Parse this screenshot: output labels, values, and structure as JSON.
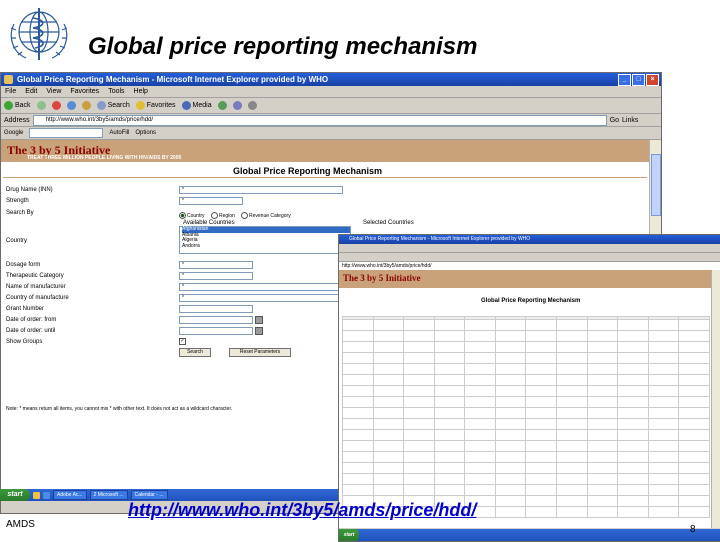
{
  "slide": {
    "title": "Global price reporting mechanism",
    "footer_left": "AMDS",
    "footer_url": "http://www.who.int/3by5/amds/price/hdd/",
    "page_number": "8"
  },
  "browser": {
    "window_title": "Global Price Reporting Mechanism - Microsoft Internet Explorer provided by WHO",
    "menu": [
      "File",
      "Edit",
      "View",
      "Favorites",
      "Tools",
      "Help"
    ],
    "toolbar": {
      "back": "Back",
      "search": "Search",
      "favorites": "Favorites",
      "media": "Media"
    },
    "address_label": "Address",
    "address_value": "http://www.who.int/3by5/amds/price/hdd/",
    "go_label": "Go",
    "links_label": "Links",
    "google_label": "Google",
    "links_items": [
      "AutoFill",
      "Options"
    ],
    "banner_logo": "The 3 by 5 Initiative",
    "banner_tagline": "TREAT THREE MILLION PEOPLE LIVING WITH HIV/AIDS BY 2005",
    "page_heading": "Global Price Reporting Mechanism",
    "form": {
      "drug_name_label": "Drug Name (INN)",
      "drug_name_value": "*",
      "strength_label": "Strength",
      "strength_value": "*",
      "search_by_label": "Search By",
      "radio_country": "Country",
      "radio_region": "Region",
      "radio_revenue": "Revenue Category",
      "available_countries_label": "Available Countries",
      "selected_countries_label": "Selected Countries",
      "country_label": "Country",
      "countries": [
        "Afghanistan",
        "Albania",
        "Algeria",
        "Andorra"
      ],
      "dosage_form_label": "Dosage form",
      "dosage_form_value": "*",
      "therapeutic_category_label": "Therapeutic Category",
      "therapeutic_category_value": "*",
      "manufacturer_label": "Name of manufacturer",
      "manufacturer_value": "*",
      "country_manufacture_label": "Country of manufacture",
      "country_manufacture_value": "*",
      "grant_number_label": "Grant Number",
      "date_from_label": "Date of order: from",
      "date_until_label": "Date of order: until",
      "show_groups_label": "Show Groups",
      "search_button": "Search",
      "reset_button": "Reset Parameters",
      "note": "Note: * means return all items, you cannot mix * with other text. It does not act as a wildcard character."
    },
    "taskbar": {
      "start": "start",
      "tasks": [
        "Adobe Ac...",
        "2 Microsoft ...",
        "Calendar - ..."
      ]
    }
  },
  "browser2": {
    "window_title": "Global Price Reporting Mechanism - Microsoft Internet Explorer provided by WHO",
    "address_value": "http://www.who.int/3by5/amds/price/hdd/",
    "banner_logo": "The 3 by 5 Initiative",
    "page_heading": "Global Price Reporting Mechanism",
    "taskbar_start": "start"
  },
  "colors": {
    "banner": "#c9a27a",
    "url": "#0000cc",
    "titlebar": "#245edb"
  }
}
